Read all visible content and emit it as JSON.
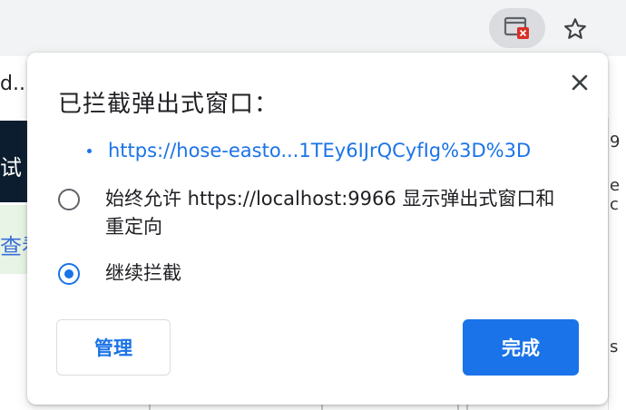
{
  "toolbar": {
    "popup_blocked_icon": "popup-blocked-icon",
    "bookmark_icon": "star-outline-icon"
  },
  "background": {
    "left_text": "d...",
    "dark_band_text": "试",
    "green_band_text": "查看",
    "right_fragments": [
      "9",
      "e c",
      "s"
    ]
  },
  "bubble": {
    "title": "已拦截弹出式窗口：",
    "close_icon": "close-icon",
    "popup_link": "https://hose-easto...1TEy6IJrQCyfIg%3D%3D",
    "options": [
      {
        "label": "始终允许 https://localhost:9966 显示弹出式窗口和重定向",
        "checked": false
      },
      {
        "label": "继续拦截",
        "checked": true
      }
    ],
    "manage_label": "管理",
    "done_label": "完成"
  },
  "colors": {
    "accent": "#1a73e8",
    "text": "#202124",
    "toolbar": "#f1f3f4"
  }
}
